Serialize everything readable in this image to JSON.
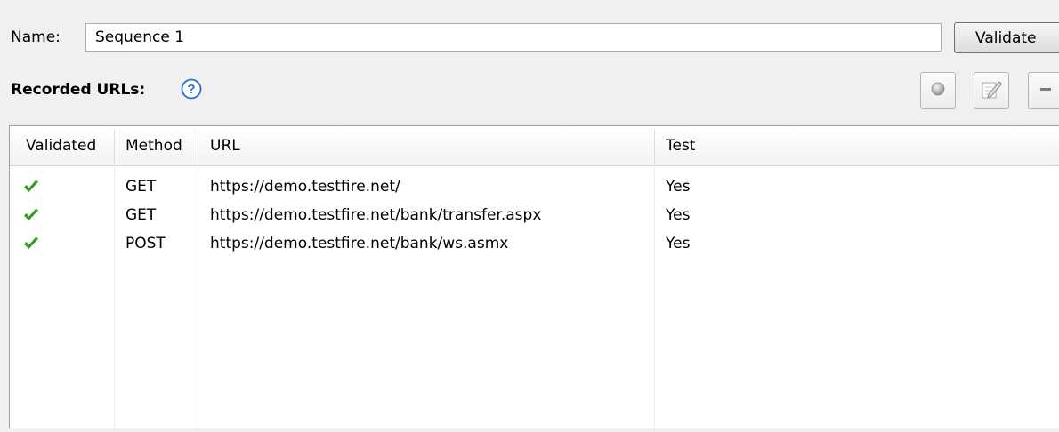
{
  "form": {
    "name_label": "Name:",
    "name_value": "Sequence 1",
    "validate_label_prefix": "",
    "validate_label_underlined": "V",
    "validate_label_rest": "alidate"
  },
  "recorded": {
    "label": "Recorded URLs:",
    "help_icon": "question-circle-icon",
    "toolbar": [
      {
        "icon": "record-icon"
      },
      {
        "icon": "edit-pencil-icon"
      },
      {
        "icon": "remove-minus-icon"
      }
    ]
  },
  "table": {
    "columns": [
      "Validated",
      "Method",
      "URL",
      "Test"
    ],
    "rows": [
      {
        "validated": "check-icon",
        "method": "GET",
        "url": "https://demo.testfire.net/",
        "test": "Yes"
      },
      {
        "validated": "check-icon",
        "method": "GET",
        "url": "https://demo.testfire.net/bank/transfer.aspx",
        "test": "Yes"
      },
      {
        "validated": "check-icon",
        "method": "POST",
        "url": "https://demo.testfire.net/bank/ws.asmx",
        "test": "Yes"
      }
    ]
  },
  "colors": {
    "check": "#2e9e1f",
    "help": "#2a6fc9"
  }
}
